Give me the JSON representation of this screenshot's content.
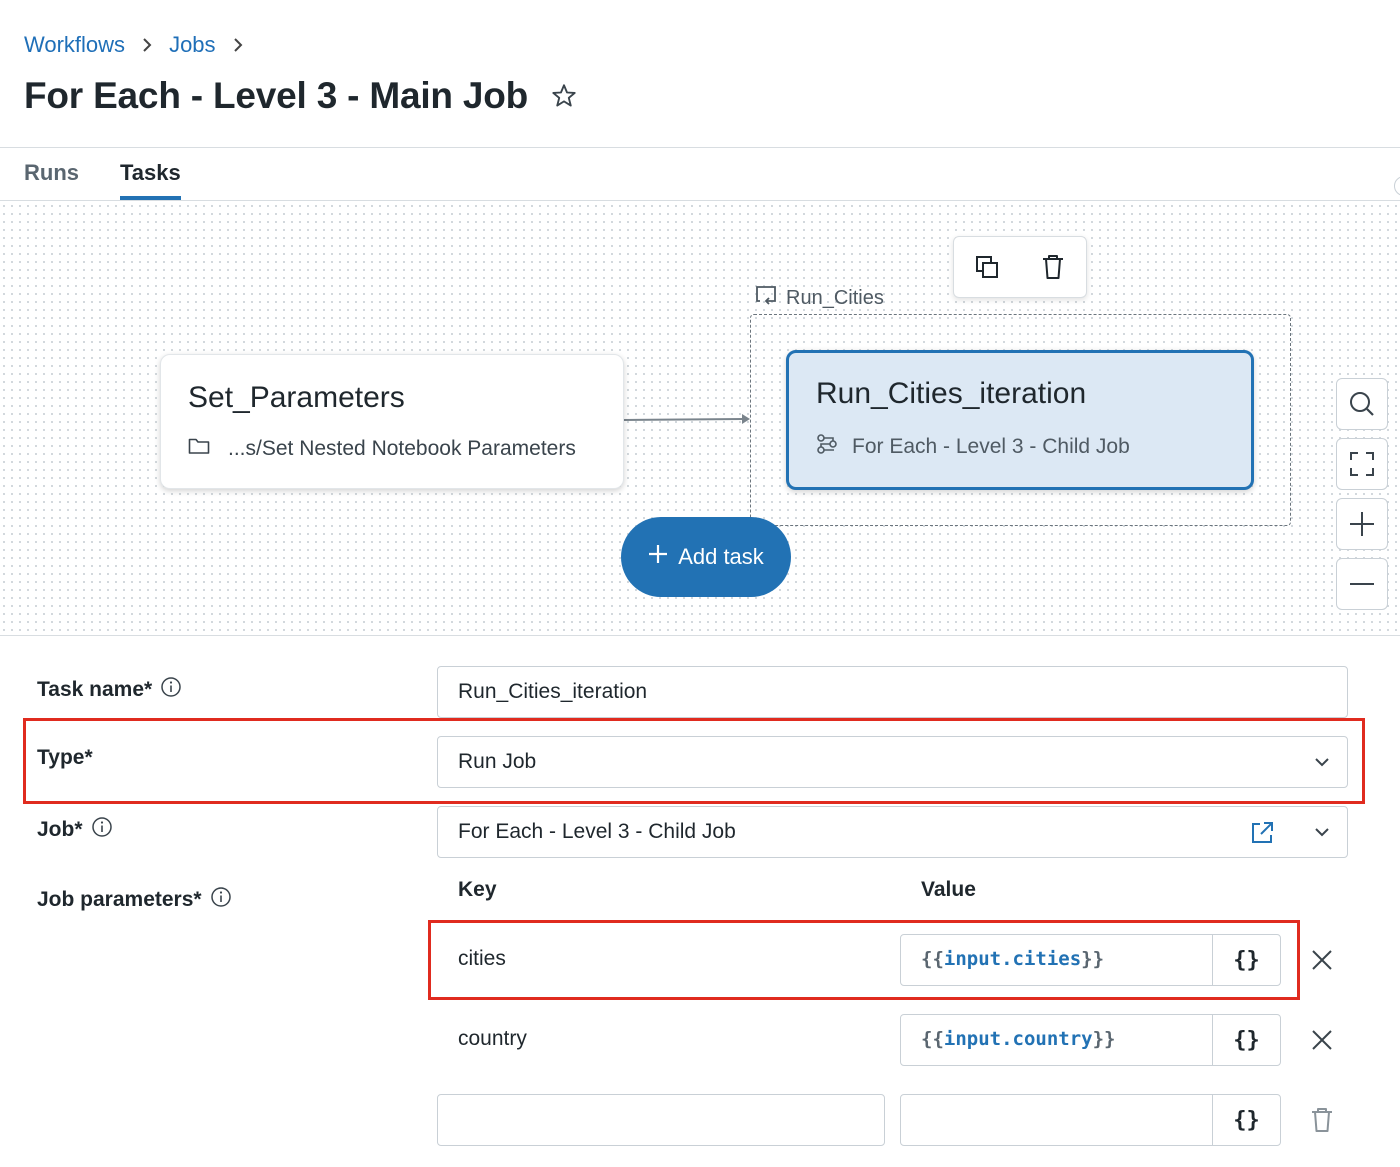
{
  "breadcrumb": {
    "workflows": "Workflows",
    "jobs": "Jobs"
  },
  "page": {
    "title": "For Each - Level 3 - Main Job"
  },
  "tabs": [
    {
      "label": "Runs",
      "active": false
    },
    {
      "label": "Tasks",
      "active": true
    }
  ],
  "graph": {
    "set_parameters": {
      "title": "Set_Parameters",
      "path": "...s/Set Nested Notebook Parameters"
    },
    "for_each_group": {
      "label": "Run_Cities"
    },
    "iteration_task": {
      "title": "Run_Cities_iteration",
      "job": "For Each - Level 3 - Child Job"
    },
    "add_task_label": "Add task"
  },
  "form": {
    "task_name": {
      "label": "Task name*",
      "value": "Run_Cities_iteration"
    },
    "type": {
      "label": "Type*",
      "value": "Run Job"
    },
    "job": {
      "label": "Job*",
      "value": "For Each - Level 3 - Child Job"
    },
    "job_parameters": {
      "label": "Job parameters*",
      "key_header": "Key",
      "value_header": "Value",
      "rows": [
        {
          "key": "cities",
          "value_open": "{{",
          "value_var": "input.cities",
          "value_close": "}}"
        },
        {
          "key": "country",
          "value_open": "{{",
          "value_var": "input.country",
          "value_close": "}}"
        }
      ],
      "dynamic_value_button": "{}"
    }
  },
  "colors": {
    "accent": "#2272b4",
    "highlight": "#e02b1f",
    "node_selected_bg": "#dce8f4"
  }
}
